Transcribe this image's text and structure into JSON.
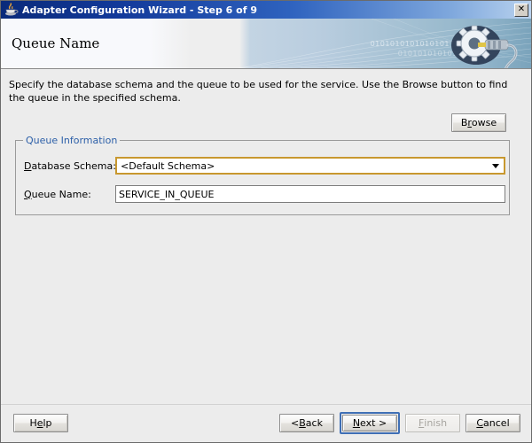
{
  "window": {
    "title": "Adapter Configuration Wizard - Step 6 of 9",
    "icon": "java-cup-icon",
    "close_label": "✕"
  },
  "header": {
    "title": "Queue Name",
    "binary_line_1": "0101010101010101",
    "binary_line_2": "01010101010101",
    "graphic": "gear-wrench-icon"
  },
  "main": {
    "description": "Specify the database schema and the queue to be used for the service. Use the Browse button to find the queue in the specified schema.",
    "browse_label": "Browse",
    "browse_mnemonic": "r",
    "group": {
      "title": "Queue Information",
      "fields": [
        {
          "label_pre": "D",
          "label_post": "atabase Schema:",
          "type": "combobox",
          "value": "<Default Schema>"
        },
        {
          "label_pre": "Q",
          "label_post": "ueue Name:",
          "type": "text",
          "value": "SERVICE_IN_QUEUE"
        }
      ]
    }
  },
  "footer": {
    "help": {
      "pre": "H",
      "mn": "e",
      "post": "lp"
    },
    "back": {
      "pre": "< ",
      "mn": "B",
      "post": "ack"
    },
    "next": {
      "pre": "",
      "mn": "N",
      "post": "ext >"
    },
    "finish": {
      "pre": "",
      "mn": "F",
      "post": "inish"
    },
    "cancel": {
      "pre": "",
      "mn": "C",
      "post": "ancel"
    }
  },
  "colors": {
    "titlebar_start": "#0a2a7a",
    "titlebar_end": "#b9d2ee",
    "group_title": "#2c5fa8",
    "combo_border": "#c8982f",
    "focus_ring": "#3f6fb5",
    "dialog_bg": "#ececec"
  }
}
